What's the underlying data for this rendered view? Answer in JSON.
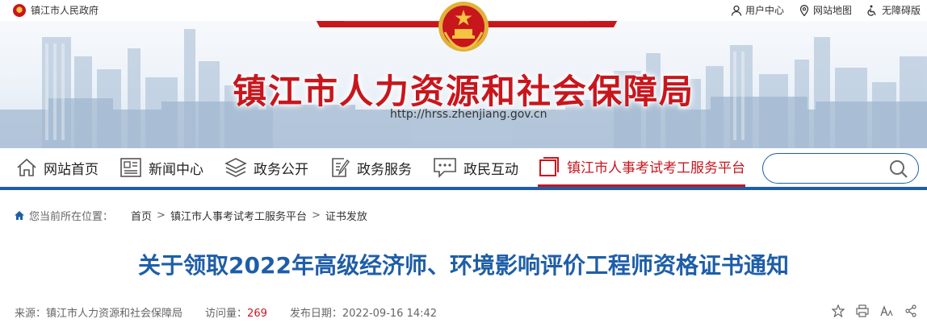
{
  "topbar": {
    "gov_name": "镇江市人民政府",
    "links": [
      {
        "label": "用户中心",
        "icon": "user-icon"
      },
      {
        "label": "网站地图",
        "icon": "map-pin-icon"
      },
      {
        "label": "无障碍版",
        "icon": "accessibility-icon"
      }
    ]
  },
  "banner": {
    "title": "镇江市人力资源和社会保障局",
    "url": "http://hrss.zhenjiang.gov.cn"
  },
  "nav": {
    "items": [
      {
        "label": "网站首页",
        "icon": "home-icon"
      },
      {
        "label": "新闻中心",
        "icon": "news-icon"
      },
      {
        "label": "政务公开",
        "icon": "layers-icon"
      },
      {
        "label": "政务服务",
        "icon": "edit-doc-icon"
      },
      {
        "label": "政民互动",
        "icon": "chat-icon"
      },
      {
        "label": "镇江市人事考试考工服务平台",
        "icon": "square-icon"
      }
    ],
    "search_placeholder": ""
  },
  "breadcrumb": {
    "prefix": "您当前所在位置：",
    "items": [
      "首页",
      "镇江市人事考试考工服务平台",
      "证书发放"
    ],
    "separator": ">"
  },
  "article": {
    "title": "关于领取2022年高级经济师、环境影响评价工程师资格证书通知",
    "source_label": "来源：",
    "source": "镇江市人力资源和社会保障局",
    "views_label": "访问量：",
    "views": "269",
    "date_label": "发布日期：",
    "date": "2022-09-16 14:42"
  },
  "colors": {
    "brand_red": "#c8161d",
    "brand_blue": "#1e5ea8"
  }
}
